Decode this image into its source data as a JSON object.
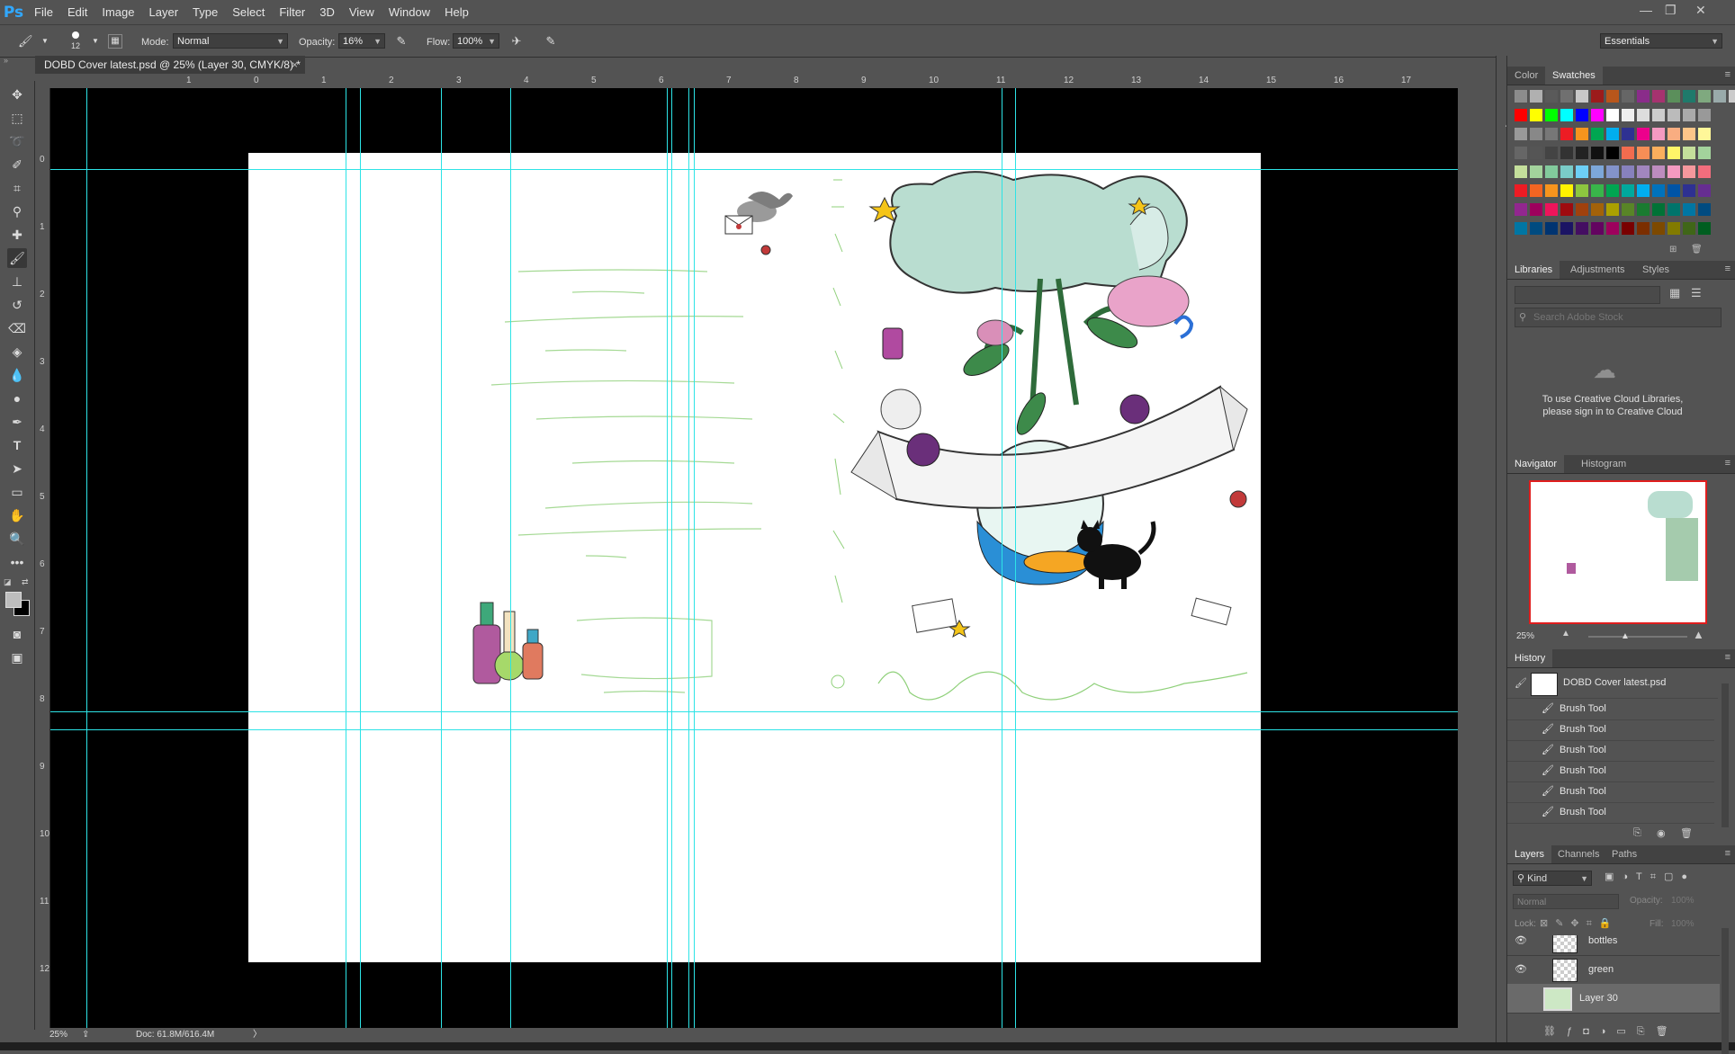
{
  "app": {
    "logo": "Ps"
  },
  "menu": [
    "File",
    "Edit",
    "Image",
    "Layer",
    "Type",
    "Select",
    "Filter",
    "3D",
    "View",
    "Window",
    "Help"
  ],
  "options": {
    "brush_size": "12",
    "mode_label": "Mode:",
    "mode_value": "Normal",
    "opacity_label": "Opacity:",
    "opacity_value": "16%",
    "flow_label": "Flow:",
    "flow_value": "100%",
    "workspace": "Essentials"
  },
  "document": {
    "tab_title": "DOBD Cover latest.psd @ 25% (Layer 30, CMYK/8) *",
    "zoom": "25%",
    "doc_size": "Doc: 61.8M/616.4M"
  },
  "rulers": {
    "horizontal": [
      "1",
      "0",
      "1",
      "2",
      "3",
      "4",
      "5",
      "6",
      "7",
      "8",
      "9",
      "10",
      "11",
      "12",
      "13",
      "14",
      "15",
      "16",
      "17"
    ],
    "vertical": [
      "0",
      "1",
      "2",
      "3",
      "4",
      "5",
      "6",
      "7",
      "8",
      "9",
      "10",
      "11",
      "12"
    ]
  },
  "color_panel": {
    "tabs": [
      "Color",
      "Swatches"
    ],
    "active_tab": "Swatches"
  },
  "libraries_panel": {
    "tabs": [
      "Libraries",
      "Adjustments",
      "Styles"
    ],
    "search_placeholder": "Search Adobe Stock",
    "message_line1": "To use Creative Cloud Libraries,",
    "message_line2": "please sign in to Creative Cloud"
  },
  "navigator_panel": {
    "tabs": [
      "Navigator",
      "Histogram"
    ],
    "zoom": "25%"
  },
  "history_panel": {
    "title": "History",
    "snapshot": "DOBD Cover latest.psd",
    "items": [
      "Brush Tool",
      "Brush Tool",
      "Brush Tool",
      "Brush Tool",
      "Brush Tool",
      "Brush Tool"
    ]
  },
  "layers_panel": {
    "tabs": [
      "Layers",
      "Channels",
      "Paths"
    ],
    "filter_kind": "Kind",
    "blend_mode": "Normal",
    "opacity_label": "Opacity:",
    "opacity_value": "100%",
    "lock_label": "Lock:",
    "fill_label": "Fill:",
    "fill_value": "100%",
    "layers": [
      {
        "name": "bottles",
        "visible": true
      },
      {
        "name": "green",
        "visible": true
      },
      {
        "name": "Layer 30",
        "visible": false,
        "selected": true
      }
    ]
  },
  "colors": {
    "ui_bg": "#535353",
    "guide": "#2de3e6",
    "accent_blue": "#31a8ff"
  }
}
